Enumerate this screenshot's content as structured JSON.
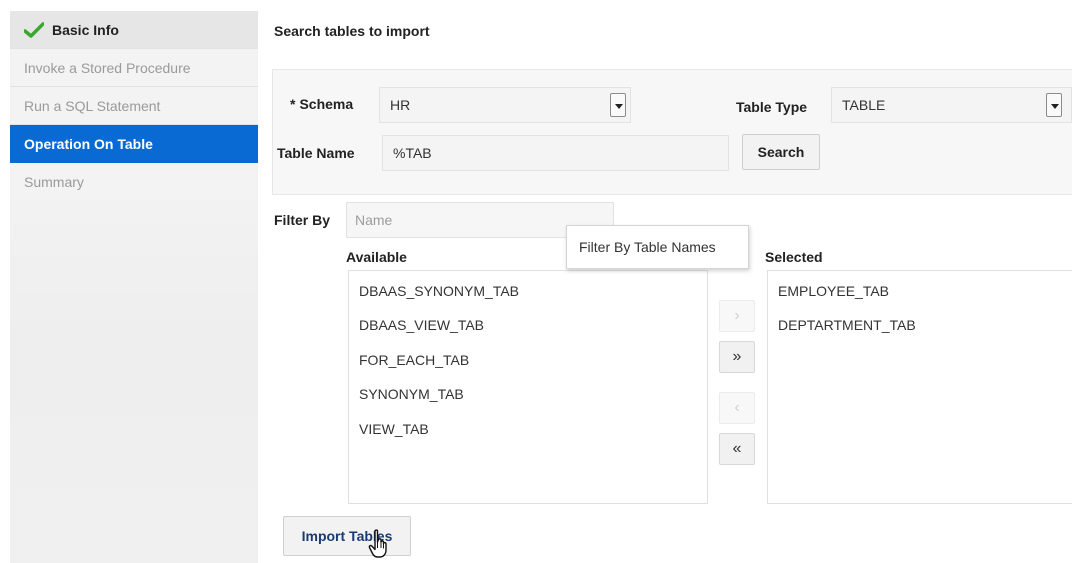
{
  "sidebar": {
    "steps": [
      {
        "label": "Basic Info",
        "state": "done"
      },
      {
        "label": "Invoke a Stored Procedure",
        "state": "pending"
      },
      {
        "label": "Run a SQL Statement",
        "state": "pending"
      },
      {
        "label": "Operation On Table",
        "state": "active"
      },
      {
        "label": "Summary",
        "state": "pending"
      }
    ],
    "check_icon": "checkmark-icon",
    "check_color": "#3aa830",
    "active_color": "#0a6ad4"
  },
  "main": {
    "title": "Search tables to import",
    "schema": {
      "required_mark": "*",
      "label": "Schema",
      "value": "HR"
    },
    "table_type": {
      "label": "Table Type",
      "value": "TABLE"
    },
    "table_name": {
      "label": "Table Name",
      "value": "%TAB"
    },
    "search_label": "Search",
    "filter": {
      "label": "Filter By",
      "placeholder": "Name",
      "tooltip": "Filter By Table Names"
    },
    "available": {
      "heading": "Available",
      "items": [
        "DBAAS_SYNONYM_TAB",
        "DBAAS_VIEW_TAB",
        "FOR_EACH_TAB",
        "SYNONYM_TAB",
        "VIEW_TAB"
      ]
    },
    "selected": {
      "heading": "Selected",
      "items": [
        "EMPLOYEE_TAB",
        "DEPTARTMENT_TAB"
      ]
    },
    "shuttle": {
      "move_selected": "›",
      "move_all": "»",
      "remove_selected": "‹",
      "remove_all": "«"
    },
    "import_label": "Import Tables"
  }
}
